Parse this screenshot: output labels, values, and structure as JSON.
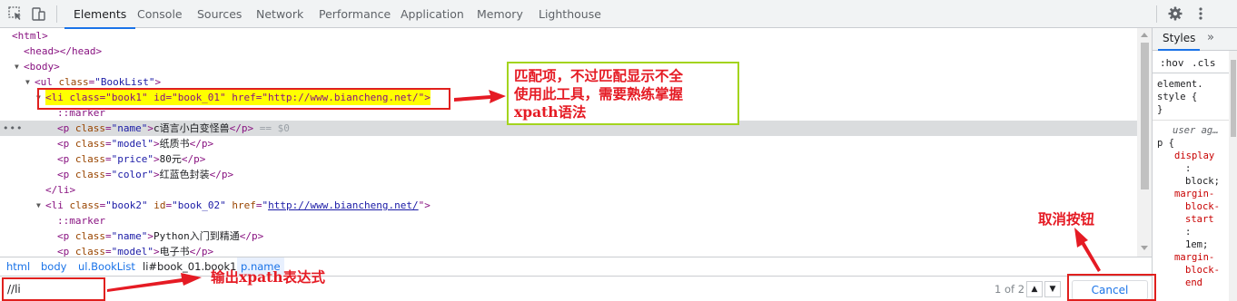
{
  "toolbar": {
    "inspect_icon": "cursor-select-icon",
    "device_icon": "device-toggle-icon",
    "tabs": [
      {
        "label": "Elements",
        "active": true
      },
      {
        "label": "Console",
        "active": false
      },
      {
        "label": "Sources",
        "active": false
      },
      {
        "label": "Network",
        "active": false
      },
      {
        "label": "Performance",
        "active": false
      },
      {
        "label": "Application",
        "active": false
      },
      {
        "label": "Memory",
        "active": false
      },
      {
        "label": "Lighthouse",
        "active": false
      }
    ],
    "settings_icon": "gear-icon",
    "menu_icon": "kebab-menu-icon"
  },
  "tree": {
    "rows": [
      {
        "open": "<html>"
      },
      {
        "open": "<head>",
        "close": "</head>"
      },
      {
        "open": "<body>"
      },
      {
        "tag_open": "<ul",
        "attr_name": "class",
        "attr_value": "\"BookList\"",
        "tag_end": ">"
      },
      {
        "highlighted": "<li class=\"book1\" id=\"book_01\" href=\"http://www.biancheng.net/\">"
      },
      {
        "text": "::marker"
      },
      {
        "tag_open": "<p",
        "attr_name": "class",
        "attr_value": "\"name\"",
        "tag_end": ">",
        "inner": "c语言小白变怪兽",
        "close": "</p>",
        "eq": " == $0"
      },
      {
        "tag_open": "<p",
        "attr_name": "class",
        "attr_value": "\"model\"",
        "tag_end": ">",
        "inner": "纸质书",
        "close": "</p>"
      },
      {
        "tag_open": "<p",
        "attr_name": "class",
        "attr_value": "\"price\"",
        "tag_end": ">",
        "inner": "80元",
        "close": "</p>"
      },
      {
        "tag_open": "<p",
        "attr_name": "class",
        "attr_value": "\"color\"",
        "tag_end": ">",
        "inner": "红蓝色封装",
        "close": "</p>"
      },
      {
        "close": "</li>"
      },
      {
        "tag_open": "<li",
        "attr1_name": "class",
        "attr1_value": "\"book2\"",
        "attr2_name": "id",
        "attr2_value": "\"book_02\"",
        "attr3_name": "href",
        "attr3_q": "\"",
        "link": "http://www.biancheng.net/",
        "tag_end": "\">"
      },
      {
        "text": "::marker"
      },
      {
        "tag_open": "<p",
        "attr_name": "class",
        "attr_value": "\"name\"",
        "tag_end": ">",
        "inner": "Python入门到精通",
        "close": "</p>"
      },
      {
        "tag_open": "<p",
        "attr_name": "class",
        "attr_value": "\"model\"",
        "tag_end": ">",
        "inner": "电子书",
        "close": "</p>"
      }
    ],
    "selected_dots": "•••"
  },
  "breadcrumb": {
    "items": [
      "html",
      "body",
      "ul.BookList",
      "li#book_01.book1",
      "p.name"
    ]
  },
  "search": {
    "value": "//li",
    "count": "1 of 2",
    "up_icon": "chevron-up-icon",
    "down_icon": "chevron-down-icon",
    "cancel_label": "Cancel"
  },
  "styles": {
    "tab_label": "Styles",
    "more_label": "»",
    "hov": ":hov",
    "cls": ".cls",
    "element_style": [
      "element.",
      "style {",
      "}"
    ],
    "ua_label": "user ag…",
    "selector": "p {",
    "props": [
      "display",
      ":",
      "block;",
      "margin-",
      "block-",
      "start",
      ":",
      "1em;",
      "margin-",
      "block-",
      "end"
    ]
  },
  "annotations": {
    "callout": [
      "匹配项，不过匹配显示不全",
      "使用此工具，需要熟练掌握",
      "xpath语法"
    ],
    "output_label": "输出xpath表达式",
    "cancel_label": "取消按钮",
    "color": "#e51b24",
    "callout_border": "#a3d41e"
  }
}
